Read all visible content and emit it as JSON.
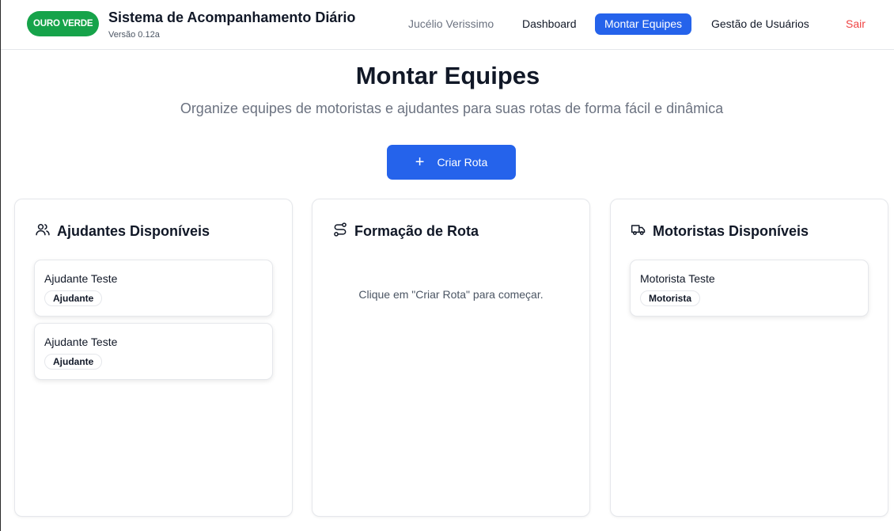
{
  "header": {
    "brand_badge": "OURO VERDE",
    "title": "Sistema de Acompanhamento Diário",
    "version": "Versão 0.12a",
    "user": "Jucélio Verissimo",
    "nav": {
      "dashboard": "Dashboard",
      "montar_equipes": "Montar Equipes",
      "gestao_usuarios": "Gestão de Usuários",
      "sair": "Sair"
    }
  },
  "main": {
    "title": "Montar Equipes",
    "subtitle": "Organize equipes de motoristas e ajudantes para suas rotas de forma fácil e dinâmica",
    "create_button": "Criar Rota"
  },
  "panels": {
    "ajudantes": {
      "title": "Ajudantes Disponíveis",
      "icon": "users-icon",
      "items": [
        {
          "name": "Ajudante Teste",
          "role": "Ajudante"
        },
        {
          "name": "Ajudante Teste",
          "role": "Ajudante"
        }
      ]
    },
    "formacao": {
      "title": "Formação de Rota",
      "icon": "route-icon",
      "empty_message": "Clique em \"Criar Rota\" para começar."
    },
    "motoristas": {
      "title": "Motoristas Disponíveis",
      "icon": "truck-icon",
      "items": [
        {
          "name": "Motorista Teste",
          "role": "Motorista"
        }
      ]
    }
  },
  "colors": {
    "brand_green": "#16a34a",
    "primary_blue": "#2563eb",
    "logout_red": "#ef4444"
  }
}
